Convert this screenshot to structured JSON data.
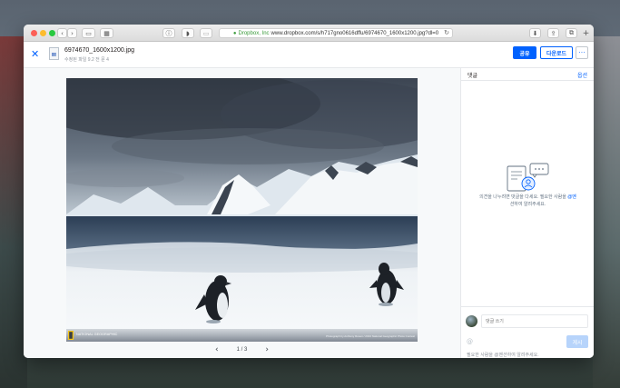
{
  "browser": {
    "secure_label": "Dropbox, Inc",
    "url": "www.dropbox.com/s/h717gno0616dffu/6974670_1600x1200.jpg?dl=0",
    "buttons": {
      "back": "‹",
      "forward": "›",
      "sidebar": "▭",
      "grid": "▦",
      "info": "ⓘ",
      "shield": "◗",
      "extension": "▭",
      "reload": "↻",
      "download": "⬇",
      "share": "⇪",
      "tabs": "⧉",
      "new_tab": "+"
    }
  },
  "header": {
    "close": "✕",
    "file_name": "6974670_1600x1200.jpg",
    "file_meta": "수정된 파일 9.2 전 문 4",
    "share_label": "공유",
    "download_label": "다운로드",
    "more_label": "···"
  },
  "preview": {
    "pager_prev": "‹",
    "pager_count": "1 / 3",
    "pager_next": "›",
    "badge_text": "NATIONAL GEOGRAPHIC",
    "credit_text": "Photograph by Anthony Rosen / 2013 National Geographic Photo Contest"
  },
  "comments": {
    "title": "댓글",
    "options": "옵션",
    "empty_line1": "의견을 나누려면 댓글을 다세요. 필요한 사람을 ",
    "empty_link": "@멘",
    "empty_line2": "션하여 알려주세요.",
    "input_placeholder": "댓글 쓰기",
    "mention_icon": "@",
    "post_label": "게시",
    "hint": "필요한 사람을 @멘션하여 알려주세요."
  },
  "colors": {
    "accent": "#0061fe",
    "post_disabled": "#b7d4fb"
  }
}
